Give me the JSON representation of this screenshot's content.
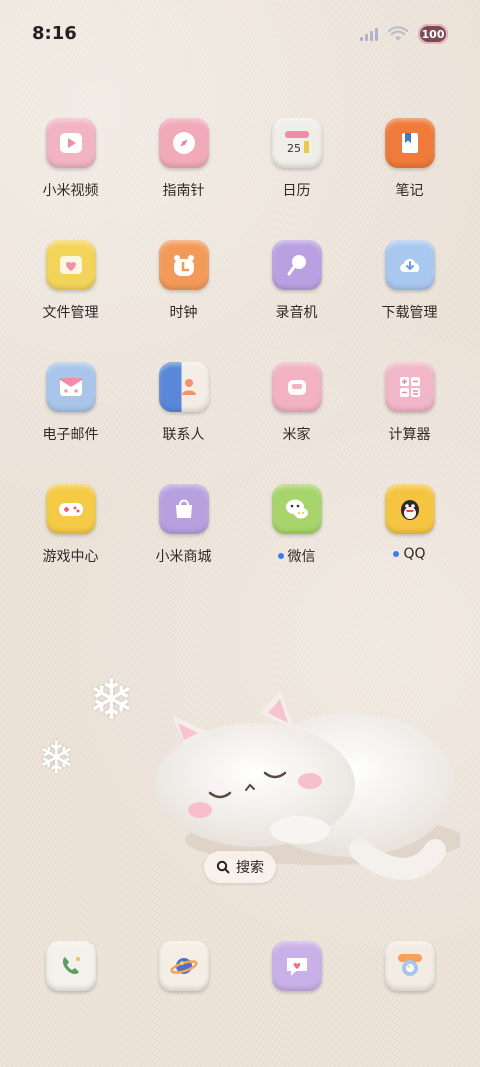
{
  "status": {
    "time": "8:16",
    "battery": "100"
  },
  "apps": [
    {
      "label": "小米视频",
      "icon": "video-icon",
      "color": "#f2b4c3"
    },
    {
      "label": "指南针",
      "icon": "compass-icon",
      "color": "#f1aab8"
    },
    {
      "label": "日历",
      "icon": "calendar-icon",
      "color": "#f0eee8",
      "day": "25"
    },
    {
      "label": "笔记",
      "icon": "notes-icon",
      "color": "#ef7a3a"
    },
    {
      "label": "文件管理",
      "icon": "folder-icon",
      "color": "#f3d45a"
    },
    {
      "label": "时钟",
      "icon": "clock-icon",
      "color": "#f39a58"
    },
    {
      "label": "录音机",
      "icon": "recorder-icon",
      "color": "#b9a1e1"
    },
    {
      "label": "下载管理",
      "icon": "download-icon",
      "color": "#a9c8ef"
    },
    {
      "label": "电子邮件",
      "icon": "mail-icon",
      "color": "#a9c6ea"
    },
    {
      "label": "联系人",
      "icon": "contacts-icon",
      "color": "#5a88d8"
    },
    {
      "label": "米家",
      "icon": "home-icon",
      "color": "#f2b2c2"
    },
    {
      "label": "计算器",
      "icon": "calculator-icon",
      "color": "#f1b6c8"
    },
    {
      "label": "游戏中心",
      "icon": "gamepad-icon",
      "color": "#f5ca45"
    },
    {
      "label": "小米商城",
      "icon": "shopping-bag-icon",
      "color": "#b8a0de"
    },
    {
      "label": "微信",
      "icon": "wechat-icon",
      "color": "#a7d46b",
      "dot": true
    },
    {
      "label": "QQ",
      "icon": "qq-penguin-icon",
      "color": "#f5c542",
      "dot": true
    }
  ],
  "search": {
    "label": "搜索"
  },
  "dock": [
    {
      "icon": "phone-icon",
      "color": "#f4f0ea"
    },
    {
      "icon": "browser-planet-icon",
      "color": "#f4eee6"
    },
    {
      "icon": "message-icon",
      "color": "#c9b0e8"
    },
    {
      "icon": "camera-icon",
      "color": "#f2ece3"
    }
  ]
}
